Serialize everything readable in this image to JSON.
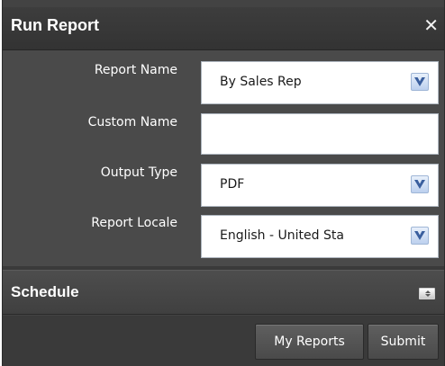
{
  "dialog": {
    "title": "Run Report",
    "close_symbol": "✕",
    "close_icon": "close-icon"
  },
  "form": {
    "report_name": {
      "label": "Report Name",
      "value": "By Sales Rep"
    },
    "custom_name": {
      "label": "Custom Name",
      "value": ""
    },
    "output_type": {
      "label": "Output Type",
      "value": "PDF"
    },
    "report_locale": {
      "label": "Report Locale",
      "value": "English - United Sta"
    },
    "dropdown_icon": "chevron-down-icon"
  },
  "schedule": {
    "title": "Schedule",
    "toggle_icon": "expand-collapse-icon"
  },
  "footer": {
    "my_reports_label": "My Reports",
    "submit_label": "Submit"
  }
}
